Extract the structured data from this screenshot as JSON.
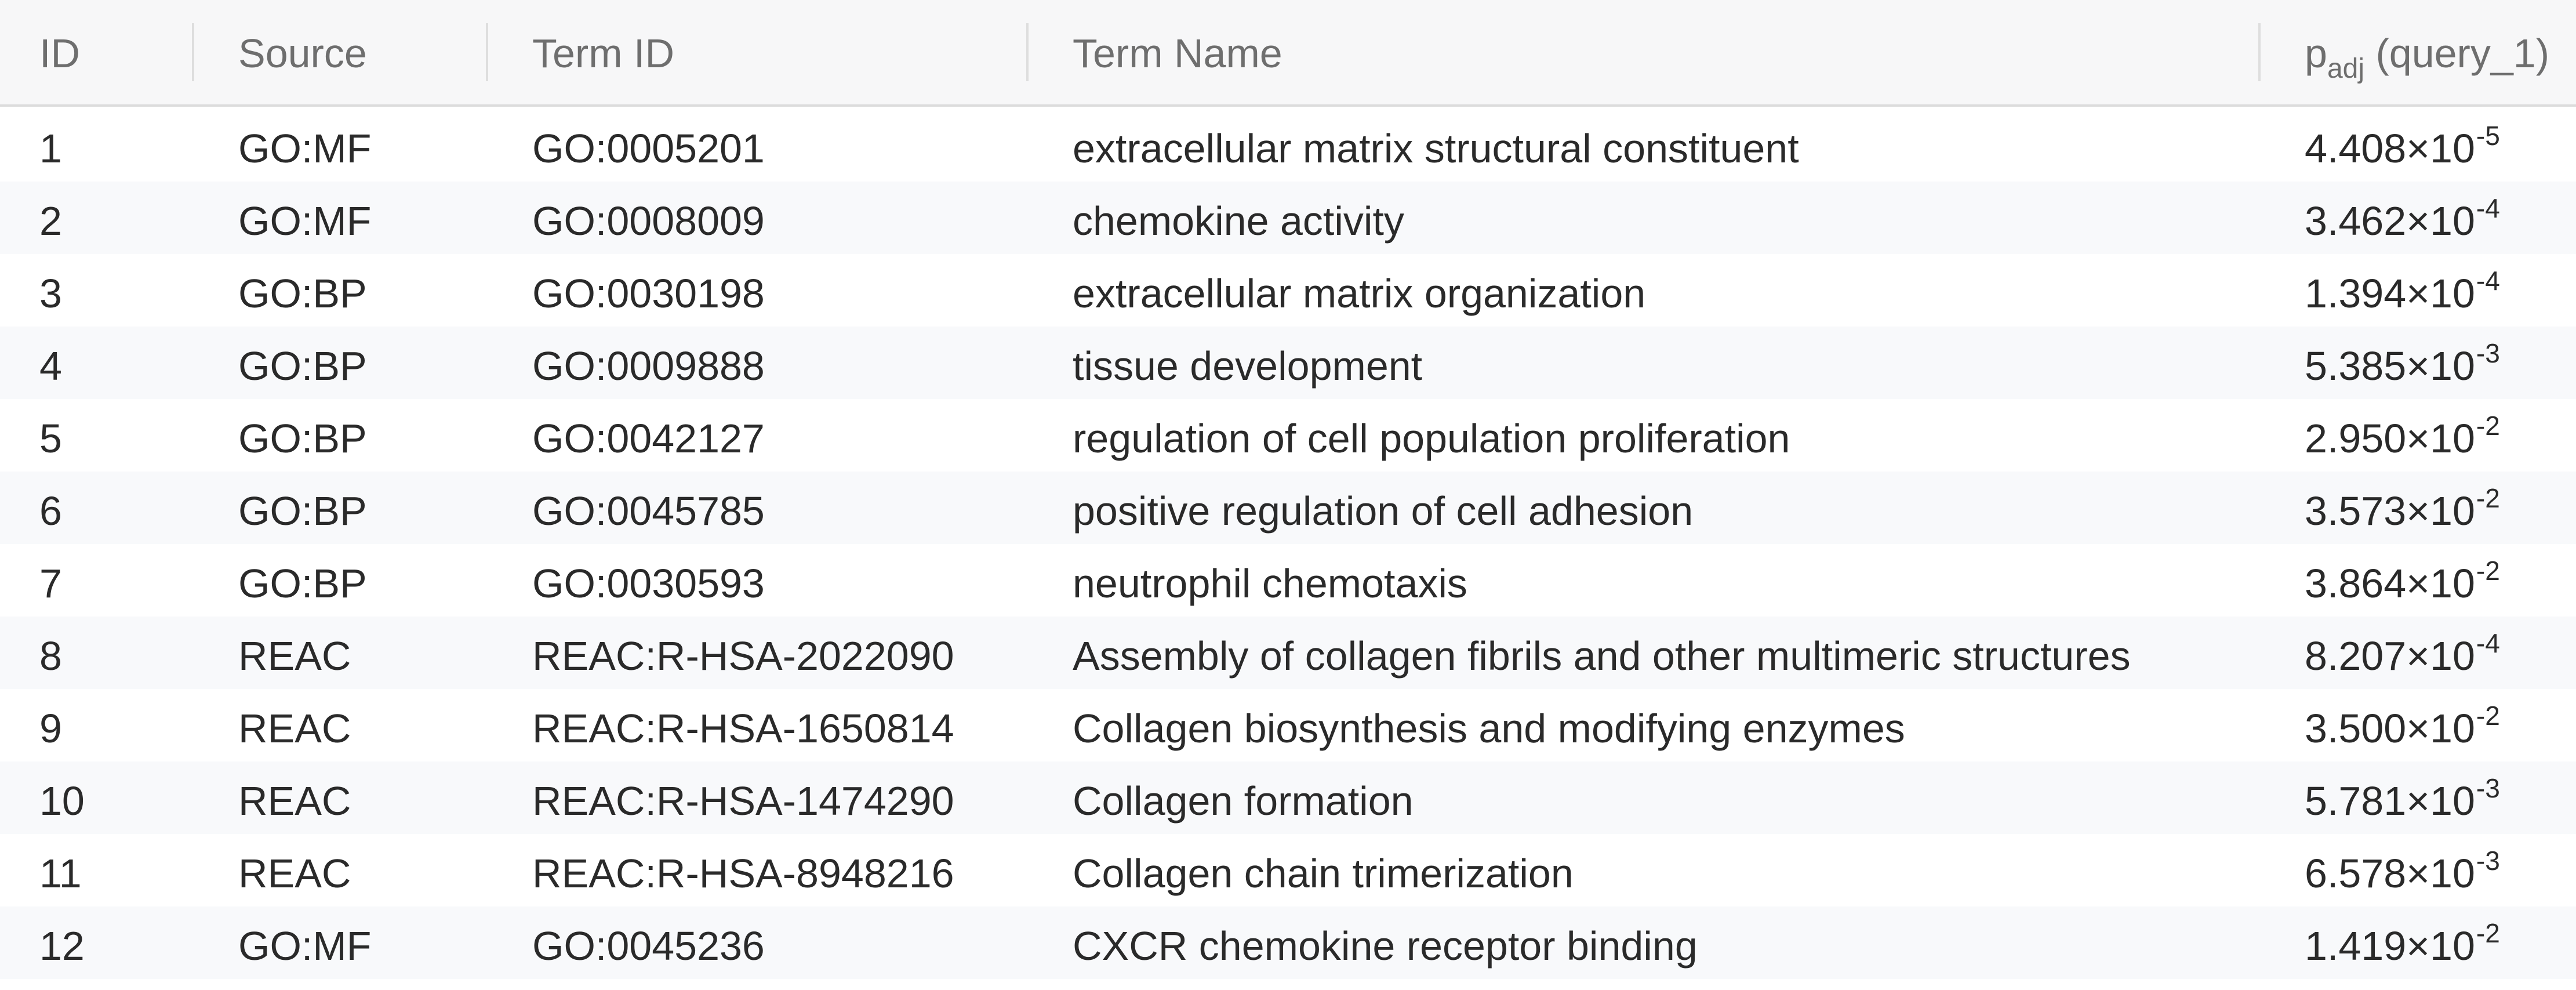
{
  "header": {
    "id": "ID",
    "source": "Source",
    "term_id": "Term ID",
    "term_name": "Term Name",
    "padj_p": "p",
    "padj_sub": "adj",
    "padj_query": " (query_1)"
  },
  "rows": [
    {
      "id": "1",
      "source": "GO:MF",
      "term_id": "GO:0005201",
      "term_name": "extracellular matrix structural constituent",
      "padj_mantissa": "4.408",
      "padj_times": "×10",
      "padj_exp": "-5"
    },
    {
      "id": "2",
      "source": "GO:MF",
      "term_id": "GO:0008009",
      "term_name": "chemokine activity",
      "padj_mantissa": "3.462",
      "padj_times": "×10",
      "padj_exp": "-4"
    },
    {
      "id": "3",
      "source": "GO:BP",
      "term_id": "GO:0030198",
      "term_name": "extracellular matrix organization",
      "padj_mantissa": "1.394",
      "padj_times": "×10",
      "padj_exp": "-4"
    },
    {
      "id": "4",
      "source": "GO:BP",
      "term_id": "GO:0009888",
      "term_name": "tissue development",
      "padj_mantissa": "5.385",
      "padj_times": "×10",
      "padj_exp": "-3"
    },
    {
      "id": "5",
      "source": "GO:BP",
      "term_id": "GO:0042127",
      "term_name": "regulation of cell population proliferation",
      "padj_mantissa": "2.950",
      "padj_times": "×10",
      "padj_exp": "-2"
    },
    {
      "id": "6",
      "source": "GO:BP",
      "term_id": "GO:0045785",
      "term_name": "positive regulation of cell adhesion",
      "padj_mantissa": "3.573",
      "padj_times": "×10",
      "padj_exp": "-2"
    },
    {
      "id": "7",
      "source": "GO:BP",
      "term_id": "GO:0030593",
      "term_name": "neutrophil chemotaxis",
      "padj_mantissa": "3.864",
      "padj_times": "×10",
      "padj_exp": "-2"
    },
    {
      "id": "8",
      "source": "REAC",
      "term_id": "REAC:R-HSA-2022090",
      "term_name": "Assembly of collagen fibrils and other multimeric structures",
      "padj_mantissa": "8.207",
      "padj_times": "×10",
      "padj_exp": "-4"
    },
    {
      "id": "9",
      "source": "REAC",
      "term_id": "REAC:R-HSA-1650814",
      "term_name": "Collagen biosynthesis and modifying enzymes",
      "padj_mantissa": "3.500",
      "padj_times": "×10",
      "padj_exp": "-2"
    },
    {
      "id": "10",
      "source": "REAC",
      "term_id": "REAC:R-HSA-1474290",
      "term_name": "Collagen formation",
      "padj_mantissa": "5.781",
      "padj_times": "×10",
      "padj_exp": "-3"
    },
    {
      "id": "11",
      "source": "REAC",
      "term_id": "REAC:R-HSA-8948216",
      "term_name": "Collagen chain trimerization",
      "padj_mantissa": "6.578",
      "padj_times": "×10",
      "padj_exp": "-3"
    },
    {
      "id": "12",
      "source": "GO:MF",
      "term_id": "GO:0045236",
      "term_name": "CXCR chemokine receptor binding",
      "padj_mantissa": "1.419",
      "padj_times": "×10",
      "padj_exp": "-2"
    }
  ]
}
